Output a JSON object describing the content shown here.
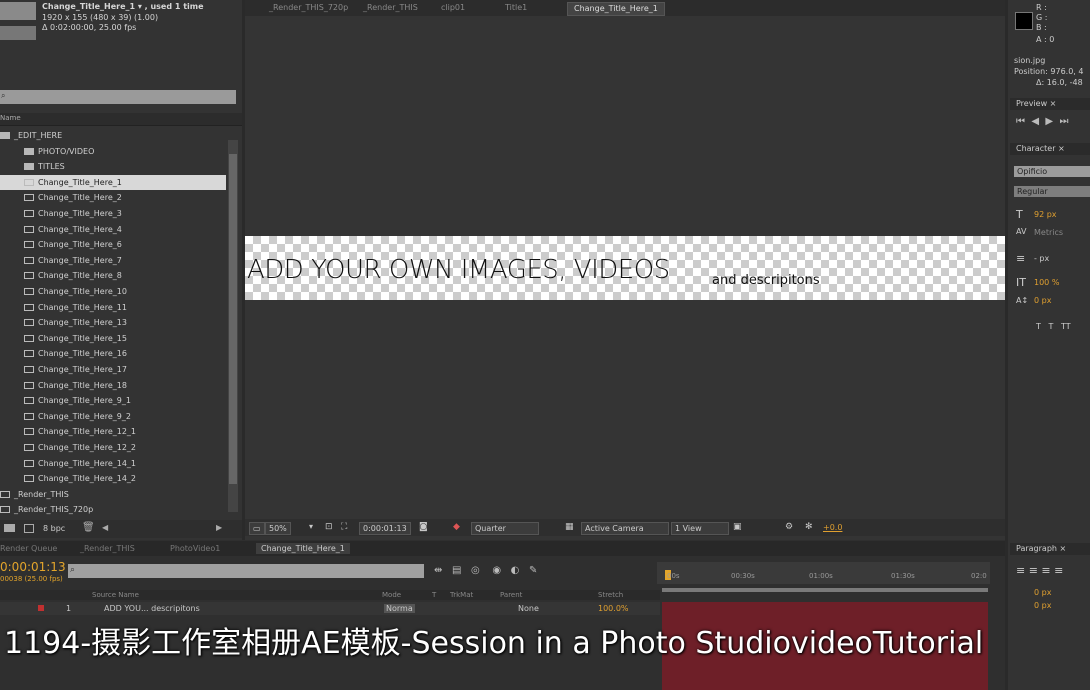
{
  "project": {
    "comp_name": "Change_Title_Here_1 ▾ , used 1 time",
    "comp_size": "1920 x 155  (480 x 39)  (1.00)",
    "comp_duration": "Δ 0:02:00:00, 25.00 fps",
    "column_header": "Name",
    "tree": [
      {
        "label": "_EDIT_HERE",
        "indent": 0,
        "kind": "folder"
      },
      {
        "label": "PHOTO/VIDEO",
        "indent": 1,
        "kind": "folder"
      },
      {
        "label": "TITLES",
        "indent": 1,
        "kind": "folder"
      },
      {
        "label": "Change_Title_Here_1",
        "indent": 2,
        "kind": "comp",
        "selected": true
      },
      {
        "label": "Change_Title_Here_2",
        "indent": 2,
        "kind": "comp"
      },
      {
        "label": "Change_Title_Here_3",
        "indent": 2,
        "kind": "comp"
      },
      {
        "label": "Change_Title_Here_4",
        "indent": 2,
        "kind": "comp"
      },
      {
        "label": "Change_Title_Here_6",
        "indent": 2,
        "kind": "comp"
      },
      {
        "label": "Change_Title_Here_7",
        "indent": 2,
        "kind": "comp"
      },
      {
        "label": "Change_Title_Here_8",
        "indent": 2,
        "kind": "comp"
      },
      {
        "label": "Change_Title_Here_10",
        "indent": 2,
        "kind": "comp"
      },
      {
        "label": "Change_Title_Here_11",
        "indent": 2,
        "kind": "comp"
      },
      {
        "label": "Change_Title_Here_13",
        "indent": 2,
        "kind": "comp"
      },
      {
        "label": "Change_Title_Here_15",
        "indent": 2,
        "kind": "comp"
      },
      {
        "label": "Change_Title_Here_16",
        "indent": 2,
        "kind": "comp"
      },
      {
        "label": "Change_Title_Here_17",
        "indent": 2,
        "kind": "comp"
      },
      {
        "label": "Change_Title_Here_18",
        "indent": 2,
        "kind": "comp"
      },
      {
        "label": "Change_Title_Here_9_1",
        "indent": 2,
        "kind": "comp"
      },
      {
        "label": "Change_Title_Here_9_2",
        "indent": 2,
        "kind": "comp"
      },
      {
        "label": "Change_Title_Here_12_1",
        "indent": 2,
        "kind": "comp"
      },
      {
        "label": "Change_Title_Here_12_2",
        "indent": 2,
        "kind": "comp"
      },
      {
        "label": "Change_Title_Here_14_1",
        "indent": 2,
        "kind": "comp"
      },
      {
        "label": "Change_Title_Here_14_2",
        "indent": 2,
        "kind": "comp"
      },
      {
        "label": "_Render_THIS",
        "indent": 0,
        "kind": "comp"
      },
      {
        "label": "_Render_THIS_720p",
        "indent": 0,
        "kind": "comp"
      }
    ],
    "bpc": "8 bpc"
  },
  "viewer": {
    "tabs": [
      "_Render_THIS_720p",
      "_Render_THIS",
      "clip01",
      "Title1",
      "Change_Title_Here_1"
    ],
    "title_text": "ADD YOUR OWN IMAGES, VIDEOS",
    "sub_text": "and descripitons",
    "zoom": "50%",
    "timecode": "0:00:01:13",
    "resolution": "Quarter",
    "camera": "Active Camera",
    "views": "1 View",
    "exposure": "+0.0"
  },
  "info": {
    "r": "R :",
    "g": "G :",
    "b": "B :",
    "a": "A : 0",
    "file": "sion.jpg",
    "position": "Position: 976.0, 4",
    "delta": "Δ: 16.0, -48"
  },
  "preview": {
    "header": "Preview ×"
  },
  "character": {
    "header": "Character ×",
    "font": "Opificio",
    "style": "Regular",
    "size": "92 px",
    "kerning": "Metrics",
    "leading": "- px",
    "vscale": "100 %",
    "baseline": "0 px"
  },
  "paragraph": {
    "header": "Paragraph ×",
    "indent1": "0 px",
    "indent2": "0 px"
  },
  "timeline": {
    "tabs": [
      "Render Queue",
      "_Render_THIS",
      "PhotoVideo1",
      "Change_Title_Here_1"
    ],
    "time": "0:00:01:13",
    "fps": "00038 (25.00 fps)",
    "ruler": [
      "00s",
      "00:30s",
      "01:00s",
      "01:30s",
      "02:0"
    ],
    "columns": [
      "Source Name",
      "Mode",
      "T",
      "TrkMat",
      "Parent",
      "Stretch"
    ],
    "layer_num": "1",
    "layer_name": "ADD YOU... descripitons",
    "layer_mode": "Norma",
    "layer_parent": "None",
    "layer_stretch": "100.0%"
  },
  "caption": "1194-摄影工作室相册AE模板-Session in a Photo StudiovideoTutorial"
}
